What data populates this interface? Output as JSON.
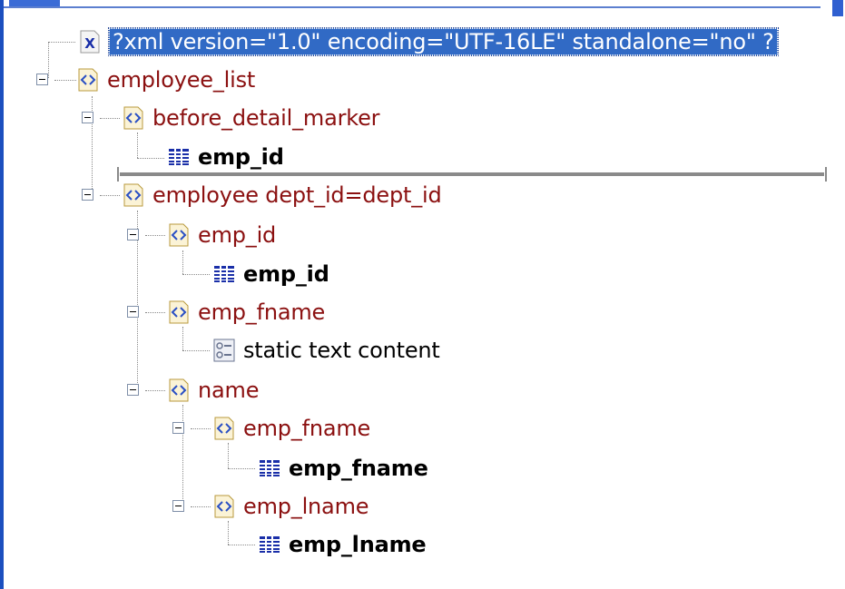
{
  "tree": {
    "declaration": {
      "label": "?xml version=\"1.0\" encoding=\"UTF-16LE\" standalone=\"no\" ?",
      "icon": "xml-declaration-icon"
    },
    "root": {
      "label": "employee_list",
      "icon": "xml-element-icon"
    },
    "before_detail_marker": {
      "label": "before_detail_marker",
      "icon": "xml-element-icon"
    },
    "before_detail_field": {
      "label": "emp_id",
      "icon": "data-column-icon"
    },
    "employee": {
      "label": "employee dept_id=dept_id",
      "icon": "xml-element-icon"
    },
    "emp_id": {
      "label": "emp_id",
      "icon": "xml-element-icon"
    },
    "emp_id_field": {
      "label": "emp_id",
      "icon": "data-column-icon"
    },
    "emp_fname": {
      "label": "emp_fname",
      "icon": "xml-element-icon"
    },
    "static_text": {
      "label": "static text content",
      "icon": "static-text-icon"
    },
    "name": {
      "label": "name",
      "icon": "xml-element-icon"
    },
    "name_fname": {
      "label": "emp_fname",
      "icon": "xml-element-icon"
    },
    "name_fname_field": {
      "label": "emp_fname",
      "icon": "data-column-icon"
    },
    "name_lname": {
      "label": "emp_lname",
      "icon": "xml-element-icon"
    },
    "name_lname_field": {
      "label": "emp_lname",
      "icon": "data-column-icon"
    }
  },
  "colors": {
    "element_text": "#8b1010",
    "selection": "#316ac5",
    "field_icon": "#1a2fa8"
  }
}
